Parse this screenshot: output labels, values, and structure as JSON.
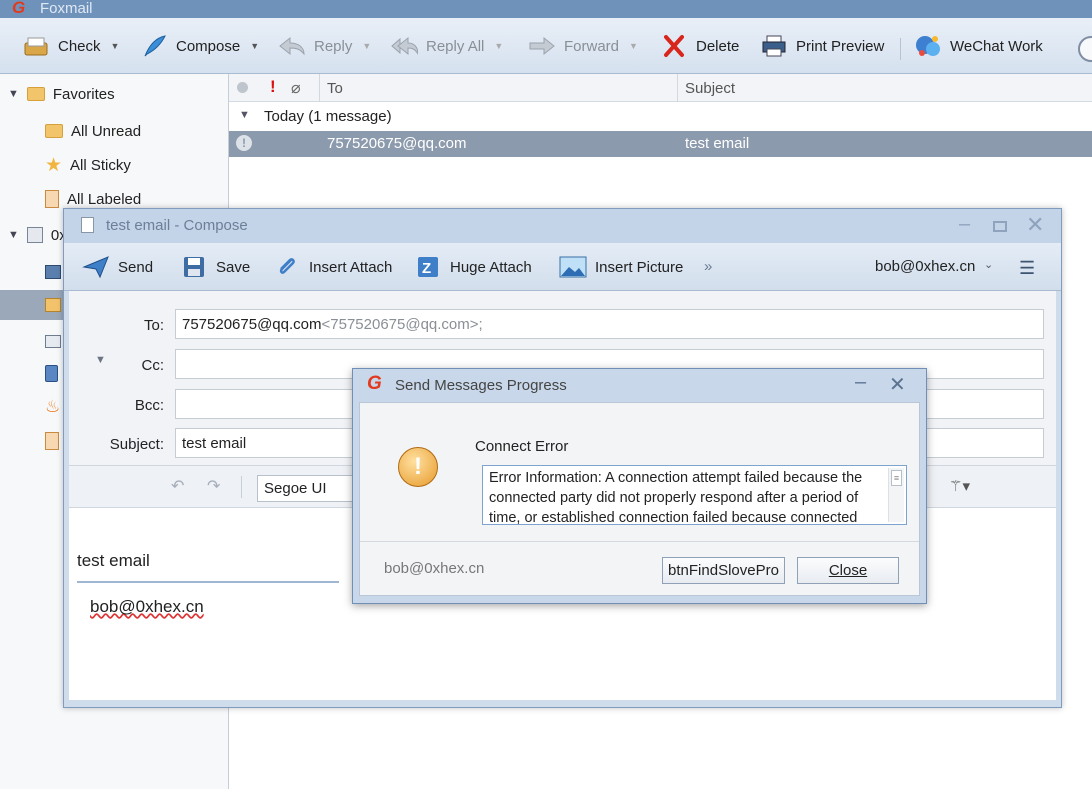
{
  "app": {
    "title": "Foxmail"
  },
  "toolbar": {
    "check": "Check",
    "compose": "Compose",
    "reply": "Reply",
    "reply_all": "Reply All",
    "forward": "Forward",
    "delete": "Delete",
    "print_preview": "Print Preview",
    "wechat_work": "WeChat Work"
  },
  "sidebar": {
    "favorites": "Favorites",
    "all_unread": "All Unread",
    "all_sticky": "All Sticky",
    "all_labeled": "All Labeled",
    "account_prefix": "0x"
  },
  "list": {
    "col_to": "To",
    "col_subject": "Subject",
    "group": "Today (1 message)",
    "rows": [
      {
        "to": "757520675@qq.com",
        "subject": "test email"
      }
    ]
  },
  "compose": {
    "title": "test email - Compose",
    "send": "Send",
    "save": "Save",
    "insert_attach": "Insert Attach",
    "huge_attach": "Huge Attach",
    "insert_picture": "Insert Picture",
    "from_account": "bob@0xhex.cn",
    "to_label": "To:",
    "cc_label": "Cc:",
    "bcc_label": "Bcc:",
    "subject_label": "Subject:",
    "to_name": "757520675@qq.com",
    "to_addr": "<757520675@qq.com>;",
    "subject_value": "test email",
    "font": "Segoe UI",
    "body_title": "test email",
    "body_sig": "bob@0xhex.cn"
  },
  "dialog": {
    "title": "Send Messages Progress",
    "heading": "Connect Error",
    "message": "Error Information: A connection attempt failed because the connected party did not properly respond after a period of time, or established connection failed because connected",
    "account": "bob@0xhex.cn",
    "btn_find": "btnFindSlovePro",
    "btn_close": "Close"
  },
  "colors": {
    "accent": "#6f92bb",
    "selection": "#8c9aad",
    "warning": "#f0b040"
  }
}
